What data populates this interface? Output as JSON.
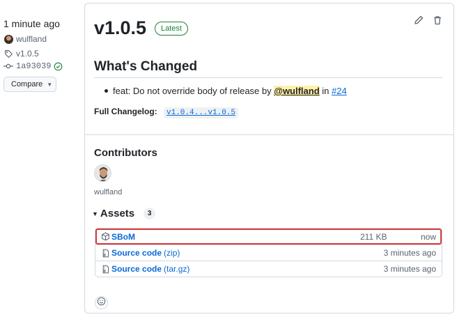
{
  "sidebar": {
    "time": "1 minute ago",
    "author": "wulfland",
    "tag": "v1.0.5",
    "commit": "1a93039",
    "compare_label": "Compare"
  },
  "release": {
    "title": "v1.0.5",
    "badge": "Latest",
    "section_title": "What's Changed",
    "change": {
      "text": "feat: Do not override body of release by",
      "mention": "@wulfland",
      "in": "in",
      "pr": "#24"
    },
    "changelog_label": "Full Changelog:",
    "changelog_link": "v1.0.4...v1.0.5"
  },
  "contributors": {
    "title": "Contributors",
    "names": [
      "wulfland"
    ]
  },
  "assets": {
    "title": "Assets",
    "count": "3",
    "items": [
      {
        "name": "SBoM",
        "suffix": "",
        "size": "211 KB",
        "when": "now",
        "icon": "package-icon"
      },
      {
        "name": "Source code",
        "suffix": "(zip)",
        "size": "",
        "when": "3 minutes ago",
        "icon": "file-zip-icon"
      },
      {
        "name": "Source code",
        "suffix": "(tar.gz)",
        "size": "",
        "when": "3 minutes ago",
        "icon": "file-zip-icon"
      }
    ]
  },
  "colors": {
    "link": "#0969da",
    "success": "#1a7f37",
    "highlight": "#d93a3a",
    "mention_bg": "#fff1a8"
  }
}
